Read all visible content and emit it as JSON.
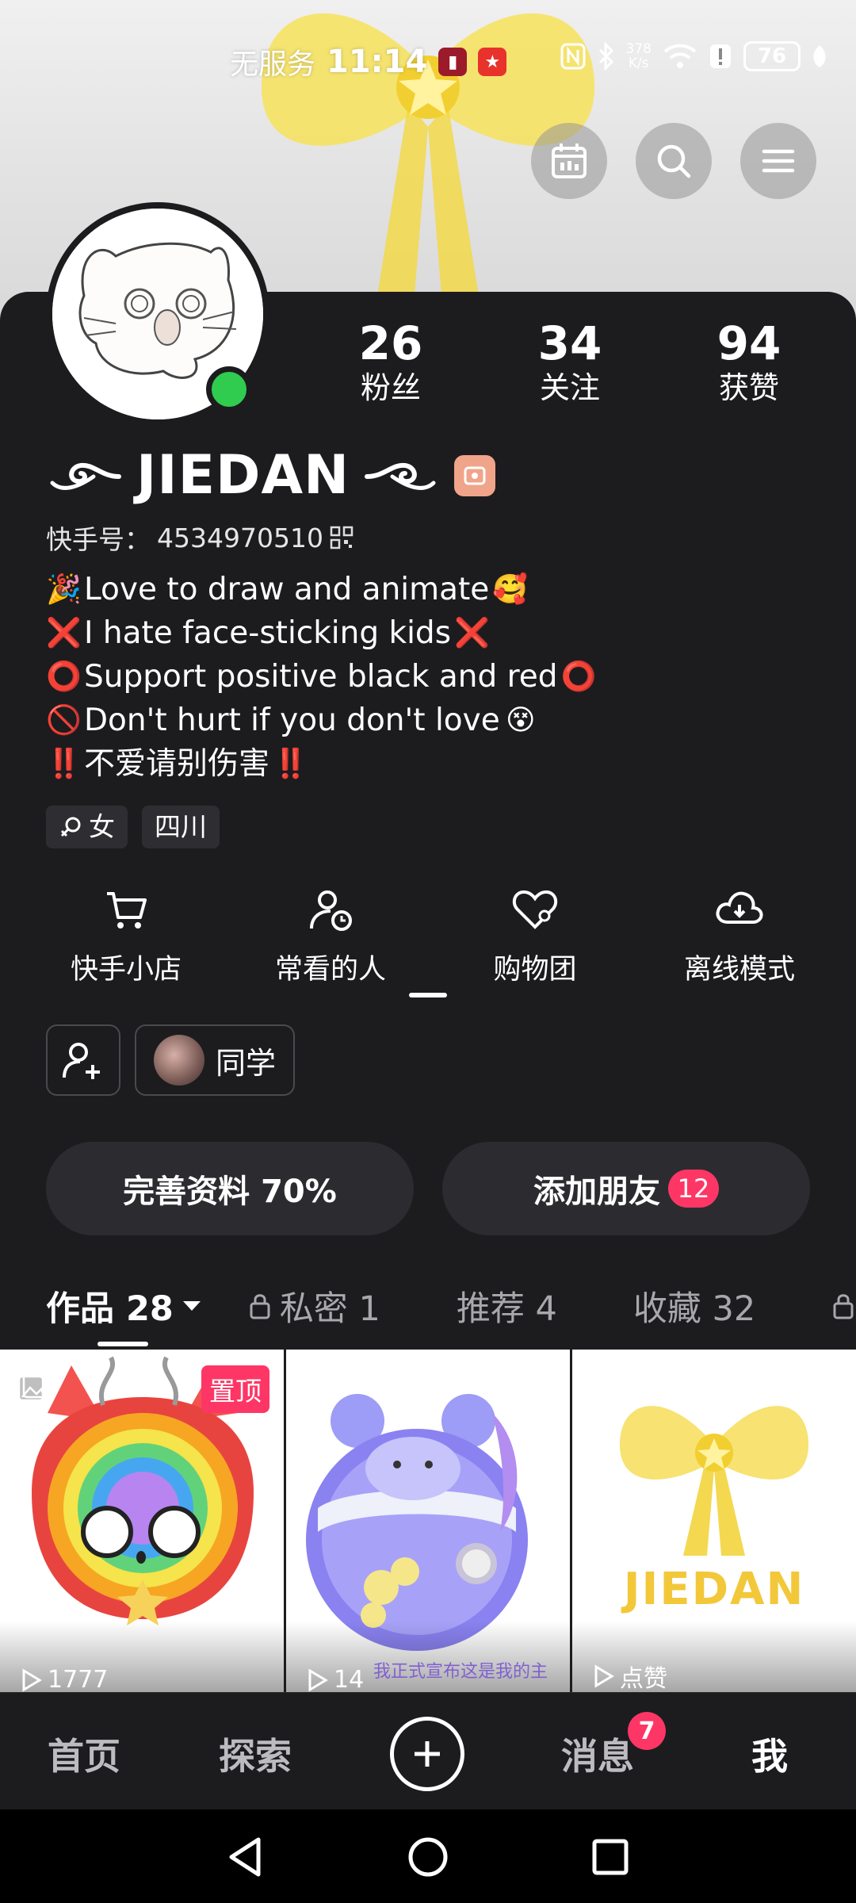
{
  "status_bar": {
    "carrier": "无服务",
    "time": "11:14",
    "net_speed_value": "378",
    "net_speed_unit": "K/s",
    "battery": "76"
  },
  "profile": {
    "stats": [
      {
        "value": "26",
        "label": "粉丝"
      },
      {
        "value": "34",
        "label": "关注"
      },
      {
        "value": "94",
        "label": "获赞"
      }
    ],
    "nickname": "JIEDAN",
    "id_label": "快手号：",
    "id_value": "4534970510",
    "bio": [
      {
        "pre": "🎉",
        "text": "Love to draw and animate",
        "post": "🥰"
      },
      {
        "pre": "❌",
        "text": "I hate face-sticking kids",
        "post": "❌"
      },
      {
        "pre": "⭕",
        "text": "Support positive black and red",
        "post": "⭕"
      },
      {
        "pre": "🚫",
        "text": "Don't hurt if you don't love",
        "post": "😵"
      },
      {
        "pre": "‼️",
        "text": "不爱请别伤害",
        "post": "‼️"
      }
    ],
    "tags": {
      "gender": "女",
      "location": "四川"
    }
  },
  "shortcuts": [
    {
      "label": "快手小店",
      "icon": "cart-icon"
    },
    {
      "label": "常看的人",
      "icon": "person-clock-icon"
    },
    {
      "label": "购物团",
      "icon": "heart-group-icon"
    },
    {
      "label": "离线模式",
      "icon": "cloud-download-icon"
    }
  ],
  "friends": {
    "classmate_label": "同学"
  },
  "buttons": {
    "complete_profile": "完善资料 70%",
    "add_friends": "添加朋友",
    "add_friends_count": "12"
  },
  "tabs": [
    {
      "label": "作品 28",
      "active": true
    },
    {
      "label": "私密 1",
      "locked": true
    },
    {
      "label": "推荐 4"
    },
    {
      "label": "收藏 32"
    }
  ],
  "grid": {
    "pinned_label": "置顶",
    "cell1_plays": "1777",
    "cell2_plays": "14",
    "cell2_caption": "我正式宣布这是我的主",
    "cell3_text": "JIEDAN",
    "cell3_plays": "点赞"
  },
  "bottom_nav": {
    "home": "首页",
    "explore": "探索",
    "messages": "消息",
    "messages_badge": "7",
    "me": "我"
  },
  "colors": {
    "background": "#1c1c1f",
    "accent_pink": "#fe3666",
    "online_green": "#2fcc4f"
  }
}
